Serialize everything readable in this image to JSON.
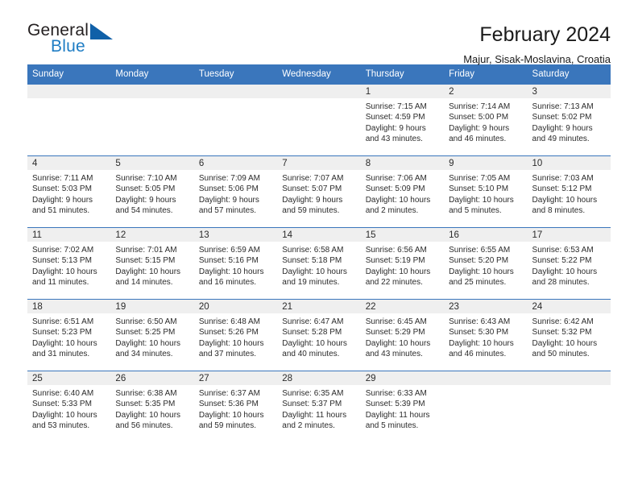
{
  "brand": {
    "word_one": "General",
    "word_two": "Blue",
    "triangle_color": "#1060a8",
    "blue_color": "#1f7dc4"
  },
  "header": {
    "title": "February 2024",
    "subtitle": "Majur, Sisak-Moslavina, Croatia"
  },
  "theme": {
    "header_row_bg": "#3a76bc",
    "daynum_bg": "#efefef",
    "grid_line": "#3a76bc"
  },
  "weekdays": [
    "Sunday",
    "Monday",
    "Tuesday",
    "Wednesday",
    "Thursday",
    "Friday",
    "Saturday"
  ],
  "weeks": [
    [
      {
        "day": "",
        "lines": []
      },
      {
        "day": "",
        "lines": []
      },
      {
        "day": "",
        "lines": []
      },
      {
        "day": "",
        "lines": []
      },
      {
        "day": "1",
        "lines": [
          "Sunrise: 7:15 AM",
          "Sunset: 4:59 PM",
          "Daylight: 9 hours",
          "and 43 minutes."
        ]
      },
      {
        "day": "2",
        "lines": [
          "Sunrise: 7:14 AM",
          "Sunset: 5:00 PM",
          "Daylight: 9 hours",
          "and 46 minutes."
        ]
      },
      {
        "day": "3",
        "lines": [
          "Sunrise: 7:13 AM",
          "Sunset: 5:02 PM",
          "Daylight: 9 hours",
          "and 49 minutes."
        ]
      }
    ],
    [
      {
        "day": "4",
        "lines": [
          "Sunrise: 7:11 AM",
          "Sunset: 5:03 PM",
          "Daylight: 9 hours",
          "and 51 minutes."
        ]
      },
      {
        "day": "5",
        "lines": [
          "Sunrise: 7:10 AM",
          "Sunset: 5:05 PM",
          "Daylight: 9 hours",
          "and 54 minutes."
        ]
      },
      {
        "day": "6",
        "lines": [
          "Sunrise: 7:09 AM",
          "Sunset: 5:06 PM",
          "Daylight: 9 hours",
          "and 57 minutes."
        ]
      },
      {
        "day": "7",
        "lines": [
          "Sunrise: 7:07 AM",
          "Sunset: 5:07 PM",
          "Daylight: 9 hours",
          "and 59 minutes."
        ]
      },
      {
        "day": "8",
        "lines": [
          "Sunrise: 7:06 AM",
          "Sunset: 5:09 PM",
          "Daylight: 10 hours",
          "and 2 minutes."
        ]
      },
      {
        "day": "9",
        "lines": [
          "Sunrise: 7:05 AM",
          "Sunset: 5:10 PM",
          "Daylight: 10 hours",
          "and 5 minutes."
        ]
      },
      {
        "day": "10",
        "lines": [
          "Sunrise: 7:03 AM",
          "Sunset: 5:12 PM",
          "Daylight: 10 hours",
          "and 8 minutes."
        ]
      }
    ],
    [
      {
        "day": "11",
        "lines": [
          "Sunrise: 7:02 AM",
          "Sunset: 5:13 PM",
          "Daylight: 10 hours",
          "and 11 minutes."
        ]
      },
      {
        "day": "12",
        "lines": [
          "Sunrise: 7:01 AM",
          "Sunset: 5:15 PM",
          "Daylight: 10 hours",
          "and 14 minutes."
        ]
      },
      {
        "day": "13",
        "lines": [
          "Sunrise: 6:59 AM",
          "Sunset: 5:16 PM",
          "Daylight: 10 hours",
          "and 16 minutes."
        ]
      },
      {
        "day": "14",
        "lines": [
          "Sunrise: 6:58 AM",
          "Sunset: 5:18 PM",
          "Daylight: 10 hours",
          "and 19 minutes."
        ]
      },
      {
        "day": "15",
        "lines": [
          "Sunrise: 6:56 AM",
          "Sunset: 5:19 PM",
          "Daylight: 10 hours",
          "and 22 minutes."
        ]
      },
      {
        "day": "16",
        "lines": [
          "Sunrise: 6:55 AM",
          "Sunset: 5:20 PM",
          "Daylight: 10 hours",
          "and 25 minutes."
        ]
      },
      {
        "day": "17",
        "lines": [
          "Sunrise: 6:53 AM",
          "Sunset: 5:22 PM",
          "Daylight: 10 hours",
          "and 28 minutes."
        ]
      }
    ],
    [
      {
        "day": "18",
        "lines": [
          "Sunrise: 6:51 AM",
          "Sunset: 5:23 PM",
          "Daylight: 10 hours",
          "and 31 minutes."
        ]
      },
      {
        "day": "19",
        "lines": [
          "Sunrise: 6:50 AM",
          "Sunset: 5:25 PM",
          "Daylight: 10 hours",
          "and 34 minutes."
        ]
      },
      {
        "day": "20",
        "lines": [
          "Sunrise: 6:48 AM",
          "Sunset: 5:26 PM",
          "Daylight: 10 hours",
          "and 37 minutes."
        ]
      },
      {
        "day": "21",
        "lines": [
          "Sunrise: 6:47 AM",
          "Sunset: 5:28 PM",
          "Daylight: 10 hours",
          "and 40 minutes."
        ]
      },
      {
        "day": "22",
        "lines": [
          "Sunrise: 6:45 AM",
          "Sunset: 5:29 PM",
          "Daylight: 10 hours",
          "and 43 minutes."
        ]
      },
      {
        "day": "23",
        "lines": [
          "Sunrise: 6:43 AM",
          "Sunset: 5:30 PM",
          "Daylight: 10 hours",
          "and 46 minutes."
        ]
      },
      {
        "day": "24",
        "lines": [
          "Sunrise: 6:42 AM",
          "Sunset: 5:32 PM",
          "Daylight: 10 hours",
          "and 50 minutes."
        ]
      }
    ],
    [
      {
        "day": "25",
        "lines": [
          "Sunrise: 6:40 AM",
          "Sunset: 5:33 PM",
          "Daylight: 10 hours",
          "and 53 minutes."
        ]
      },
      {
        "day": "26",
        "lines": [
          "Sunrise: 6:38 AM",
          "Sunset: 5:35 PM",
          "Daylight: 10 hours",
          "and 56 minutes."
        ]
      },
      {
        "day": "27",
        "lines": [
          "Sunrise: 6:37 AM",
          "Sunset: 5:36 PM",
          "Daylight: 10 hours",
          "and 59 minutes."
        ]
      },
      {
        "day": "28",
        "lines": [
          "Sunrise: 6:35 AM",
          "Sunset: 5:37 PM",
          "Daylight: 11 hours",
          "and 2 minutes."
        ]
      },
      {
        "day": "29",
        "lines": [
          "Sunrise: 6:33 AM",
          "Sunset: 5:39 PM",
          "Daylight: 11 hours",
          "and 5 minutes."
        ]
      },
      {
        "day": "",
        "lines": []
      },
      {
        "day": "",
        "lines": []
      }
    ]
  ]
}
